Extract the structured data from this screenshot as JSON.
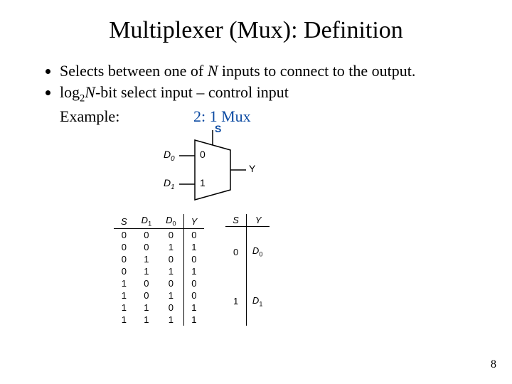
{
  "title": "Multiplexer (Mux): Definition",
  "bullets": {
    "b1a": "Selects between one of ",
    "b1N": "N",
    "b1b": " inputs to connect to the output.",
    "b2a": "log",
    "b2sub": "2",
    "b2N": "N",
    "b2b": "-bit select input – control input",
    "b3": "Example:"
  },
  "mux_label": "2: 1 Mux",
  "diagram": {
    "S": "S",
    "D0": "D",
    "D0s": "0",
    "D1": "D",
    "D1s": "1",
    "in0": "0",
    "in1": "1",
    "Y": "Y"
  },
  "truth_table": {
    "headers": {
      "S": "S",
      "D1": "D",
      "D1s": "1",
      "D0": "D",
      "D0s": "0",
      "Y": "Y"
    },
    "rows": [
      {
        "S": "0",
        "D1": "0",
        "D0": "0",
        "Y": "0"
      },
      {
        "S": "0",
        "D1": "0",
        "D0": "1",
        "Y": "1"
      },
      {
        "S": "0",
        "D1": "1",
        "D0": "0",
        "Y": "0"
      },
      {
        "S": "0",
        "D1": "1",
        "D0": "1",
        "Y": "1"
      },
      {
        "S": "1",
        "D1": "0",
        "D0": "0",
        "Y": "0"
      },
      {
        "S": "1",
        "D1": "0",
        "D0": "1",
        "Y": "0"
      },
      {
        "S": "1",
        "D1": "1",
        "D0": "0",
        "Y": "1"
      },
      {
        "S": "1",
        "D1": "1",
        "D0": "1",
        "Y": "1"
      }
    ]
  },
  "compact_table": {
    "headers": {
      "S": "S",
      "Y": "Y"
    },
    "rows": [
      {
        "S": "0",
        "Y": "D",
        "Ys": "0"
      },
      {
        "S": "1",
        "Y": "D",
        "Ys": "1"
      }
    ]
  },
  "page_number": "8"
}
